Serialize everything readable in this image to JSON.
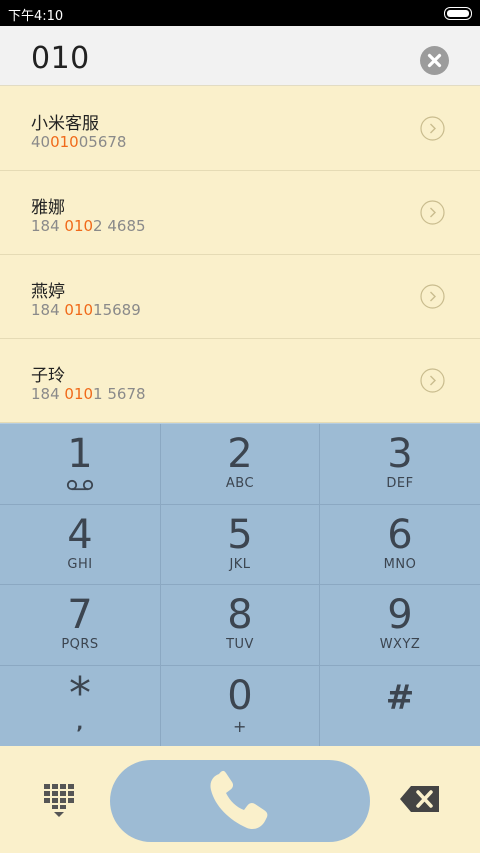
{
  "status_bar": {
    "time": "下午4:10"
  },
  "dial_input": {
    "value": "010"
  },
  "contacts": [
    {
      "name": "小米客服",
      "number_pre": "40",
      "number_match": "010",
      "number_post": "05678"
    },
    {
      "name": "雅娜",
      "number_pre": "184 ",
      "number_match": "010",
      "number_post": "2 4685"
    },
    {
      "name": "燕婷",
      "number_pre": "184 ",
      "number_match": "010",
      "number_post": "15689"
    },
    {
      "name": "子玲",
      "number_pre": "184 ",
      "number_match": "010",
      "number_post": "1 5678"
    }
  ],
  "keypad": {
    "k1": {
      "digit": "1"
    },
    "k2": {
      "digit": "2",
      "letters": "ABC"
    },
    "k3": {
      "digit": "3",
      "letters": "DEF"
    },
    "k4": {
      "digit": "4",
      "letters": "GHI"
    },
    "k5": {
      "digit": "5",
      "letters": "JKL"
    },
    "k6": {
      "digit": "6",
      "letters": "MNO"
    },
    "k7": {
      "digit": "7",
      "letters": "PQRS"
    },
    "k8": {
      "digit": "8",
      "letters": "TUV"
    },
    "k9": {
      "digit": "9",
      "letters": "WXYZ"
    },
    "kstar": {
      "digit": "*",
      "letters": ","
    },
    "k0": {
      "digit": "0",
      "letters": "+"
    },
    "khash": {
      "digit": "#"
    }
  },
  "icons": {
    "clear": "clear-x-icon",
    "chevron": "chevron-right-circle-icon",
    "voicemail": "voicemail-icon",
    "keypad_toggle": "dialpad-toggle-icon",
    "call": "phone-handset-icon",
    "backspace": "backspace-icon"
  },
  "colors": {
    "list_bg": "#faf0cb",
    "keypad_bg": "#9dbbd4",
    "match_highlight": "#f06a1a",
    "key_text": "#3c4550"
  }
}
